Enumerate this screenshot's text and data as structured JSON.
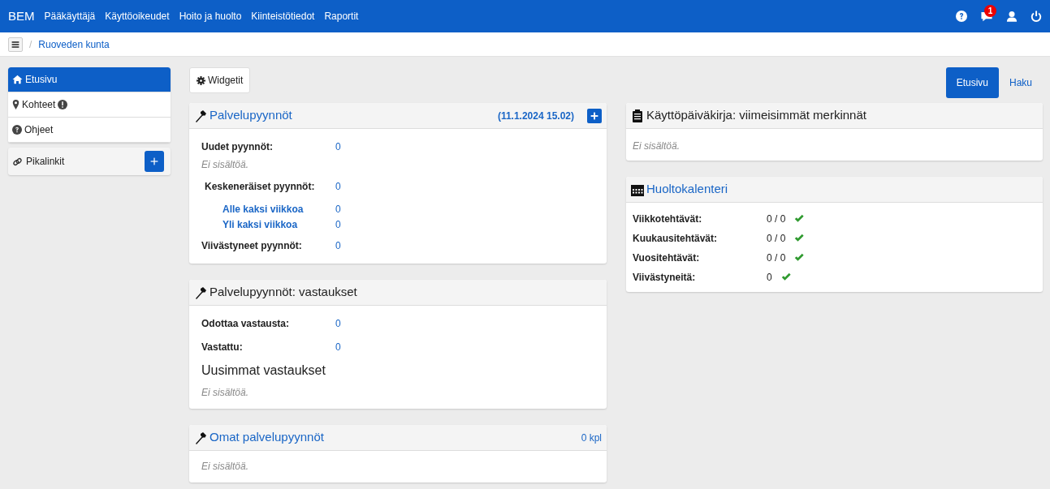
{
  "navbar": {
    "brand": "BEM",
    "menu": [
      "Pääkäyttäjä",
      "Käyttöoikeudet",
      "Hoito ja huolto",
      "Kiinteistötiedot",
      "Raportit"
    ],
    "notification_count": "1"
  },
  "breadcrumb": {
    "separator": "/",
    "items": [
      "Ruoveden kunta"
    ]
  },
  "sidebar": {
    "items": [
      {
        "label": "Etusivu",
        "selected": true,
        "alert": false
      },
      {
        "label": "Kohteet",
        "selected": false,
        "alert": true
      },
      {
        "label": "Ohjeet",
        "selected": false,
        "alert": false
      }
    ],
    "quicklinks": {
      "label": "Pikalinkit"
    }
  },
  "toolbar": {
    "widgets_button": "Widgetit"
  },
  "view_tabs": [
    {
      "label": "Etusivu",
      "selected": true
    },
    {
      "label": "Haku",
      "selected": false
    }
  ],
  "left_cards": [
    {
      "title": "Palvelupyynnöt",
      "link": true,
      "info": "(11.1.2024 15.02)",
      "add_button": true,
      "rows": [
        {
          "kind": "stat",
          "label": "Uudet pyynnöt:",
          "value": "0"
        },
        {
          "kind": "empty",
          "text": "Ei sisältöä."
        },
        {
          "kind": "stat",
          "label": "Keskeneräiset pyynnöt:",
          "value": "0"
        },
        {
          "kind": "sub",
          "label": "Alle kaksi viikkoa",
          "value": "0"
        },
        {
          "kind": "sub",
          "label": "Yli kaksi viikkoa",
          "value": "0"
        },
        {
          "kind": "stat",
          "label": "Viivästyneet pyynnöt:",
          "value": "0"
        }
      ]
    },
    {
      "title": "Palvelupyynnöt: vastaukset",
      "link": false,
      "rows": [
        {
          "kind": "stat",
          "label": "Odottaa vastausta:",
          "value": "0"
        },
        {
          "kind": "stat",
          "label": "Vastattu:",
          "value": "0"
        },
        {
          "kind": "heading",
          "text": "Uusimmat vastaukset"
        },
        {
          "kind": "empty",
          "text": "Ei sisältöä."
        }
      ]
    },
    {
      "title": "Omat palvelupyynnöt",
      "link": true,
      "count": "0 kpl",
      "rows": [
        {
          "kind": "empty",
          "text": "Ei sisältöä."
        }
      ]
    }
  ],
  "right_cards": [
    {
      "title": "Käyttöpäiväkirja: viimeisimmät merkinnät",
      "link": false,
      "rows": [
        {
          "kind": "empty",
          "text": "Ei sisältöä."
        }
      ]
    },
    {
      "title": "Huoltokalenteri",
      "link": true,
      "rows": [
        {
          "kind": "task",
          "label": "Viikkotehtävät:",
          "value": "0 / 0",
          "ok": true
        },
        {
          "kind": "task",
          "label": "Kuukausitehtävät:",
          "value": "0 / 0",
          "ok": true
        },
        {
          "kind": "task",
          "label": "Vuositehtävät:",
          "value": "0 / 0",
          "ok": true
        },
        {
          "kind": "task",
          "label": "Viivästyneitä:",
          "value": "0",
          "ok": true
        }
      ]
    }
  ]
}
